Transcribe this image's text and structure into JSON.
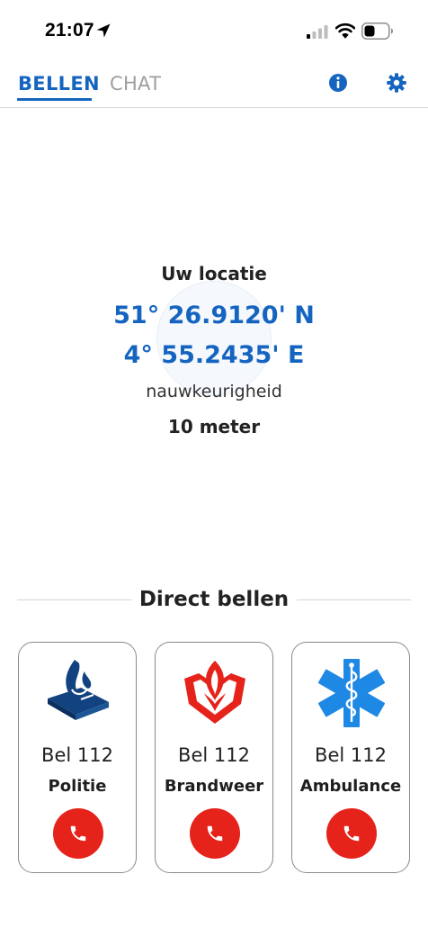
{
  "status_bar": {
    "time": "21:07",
    "icons": [
      "location-arrow-icon",
      "cellular-signal-icon",
      "wifi-icon",
      "battery-icon"
    ]
  },
  "tabs": [
    {
      "label": "BELLEN",
      "active": true
    },
    {
      "label": "CHAT",
      "active": false
    }
  ],
  "header_icons": [
    "info-icon",
    "gear-icon"
  ],
  "location": {
    "title": "Uw locatie",
    "latitude": "51° 26.9120' N",
    "longitude": "4° 55.2435' E",
    "accuracy_label": "nauwkeurigheid",
    "accuracy_value": "10 meter"
  },
  "direct_call": {
    "title": "Direct bellen",
    "cards": [
      {
        "icon": "police-emblem-icon",
        "call_label": "Bel 112",
        "service": "Politie"
      },
      {
        "icon": "fire-department-emblem-icon",
        "call_label": "Bel 112",
        "service": "Brandweer"
      },
      {
        "icon": "star-of-life-icon",
        "call_label": "Bel 112",
        "service": "Ambulance"
      }
    ]
  },
  "colors": {
    "accent": "#1565c0",
    "inactive_tab": "#9e9e9e",
    "call_button": "#e5231b",
    "police": "#12427f",
    "fire": "#e5231b",
    "ambulance": "#1e88e5"
  }
}
